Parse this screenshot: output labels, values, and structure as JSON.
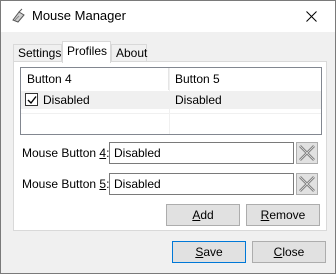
{
  "window": {
    "title": "Mouse Manager"
  },
  "tabs": [
    {
      "label": "Settings"
    },
    {
      "label": "Profiles"
    },
    {
      "label": "About"
    }
  ],
  "profiles": {
    "columns": [
      "Button 4",
      "Button 5"
    ],
    "rows": [
      {
        "checked": true,
        "button4": "Disabled",
        "button5": "Disabled"
      }
    ],
    "mouse_button_4": {
      "label_prefix": "Mouse Button ",
      "label_key": "4",
      "label_suffix": ":",
      "value": "Disabled"
    },
    "mouse_button_5": {
      "label_prefix": "Mouse Button ",
      "label_key": "5",
      "label_suffix": ":",
      "value": "Disabled"
    },
    "add_prefix": "A",
    "add_rest": "dd",
    "remove_prefix": "R",
    "remove_rest": "emove"
  },
  "footer": {
    "save_prefix": "S",
    "save_rest": "ave",
    "close_prefix": "C",
    "close_rest": "lose"
  },
  "icons": {
    "app": "mouse-icon",
    "clear": "clear-x-icon",
    "close": "close-icon"
  }
}
